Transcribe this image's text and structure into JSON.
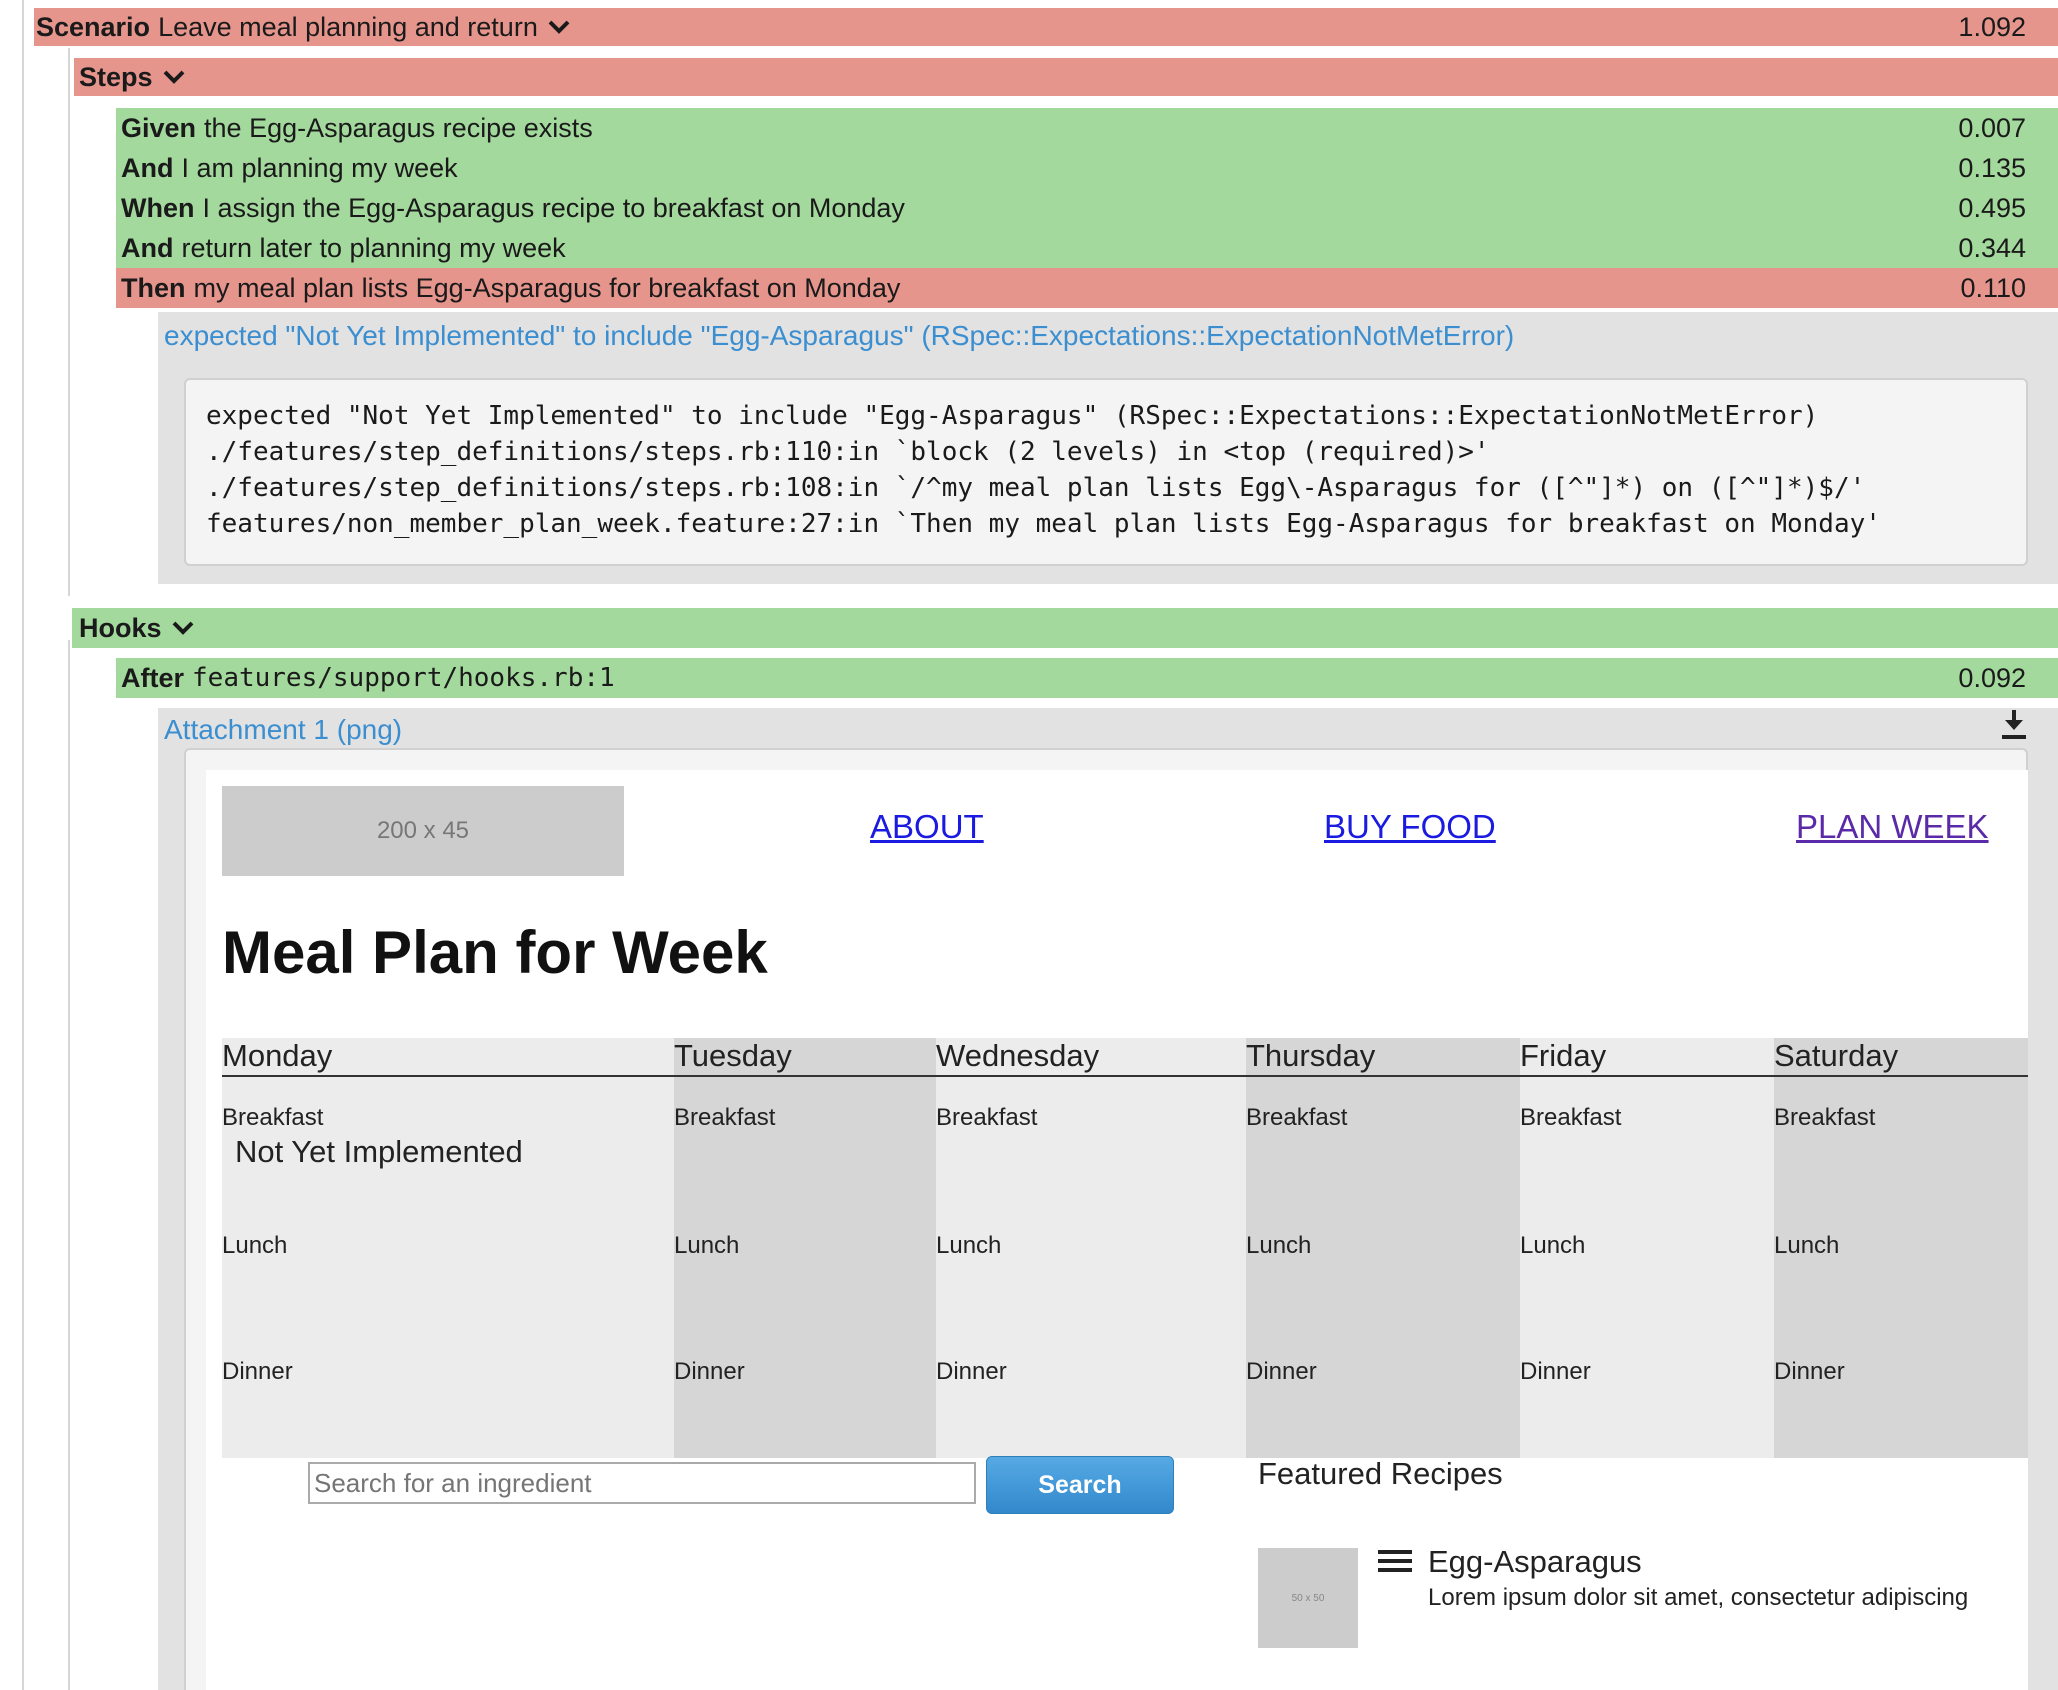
{
  "scenario": {
    "keyword": "Scenario",
    "name": "Leave meal planning and return",
    "time": "1.092"
  },
  "steps_section": {
    "label": "Steps"
  },
  "steps": [
    {
      "keyword": "Given",
      "text": "the Egg-Asparagus recipe exists",
      "time": "0.007",
      "status": "passed"
    },
    {
      "keyword": "And",
      "text": "I am planning my week",
      "time": "0.135",
      "status": "passed"
    },
    {
      "keyword": "When",
      "text": "I assign the Egg-Asparagus recipe to breakfast on Monday",
      "time": "0.495",
      "status": "passed"
    },
    {
      "keyword": "And",
      "text": "return later to planning my week",
      "time": "0.344",
      "status": "passed"
    },
    {
      "keyword": "Then",
      "text": "my meal plan lists Egg-Asparagus for breakfast on Monday",
      "time": "0.110",
      "status": "failed"
    }
  ],
  "error": {
    "message": "expected \"Not Yet Implemented\" to include \"Egg-Asparagus\" (RSpec::Expectations::ExpectationNotMetError)",
    "trace": [
      "expected \"Not Yet Implemented\" to include \"Egg-Asparagus\" (RSpec::Expectations::ExpectationNotMetError)",
      "./features/step_definitions/steps.rb:110:in `block (2 levels) in <top (required)>'",
      "./features/step_definitions/steps.rb:108:in `/^my meal plan lists Egg\\-Asparagus for ([^\"]*) on ([^\"]*)$/'",
      "features/non_member_plan_week.feature:27:in `Then my meal plan lists Egg-Asparagus for breakfast on Monday'"
    ]
  },
  "hooks_section": {
    "label": "Hooks"
  },
  "hook": {
    "keyword": "After",
    "location": "features/support/hooks.rb:1",
    "time": "0.092"
  },
  "attachment": {
    "label": "Attachment 1 (png)",
    "download_icon": "download-icon"
  },
  "screenshot": {
    "logo_placeholder": "200 x 45",
    "nav": [
      "ABOUT",
      "BUY FOOD",
      "PLAN WEEK"
    ],
    "heading": "Meal Plan for Week",
    "days": [
      "Monday",
      "Tuesday",
      "Wednesday",
      "Thursday",
      "Friday",
      "Saturday"
    ],
    "meals": [
      "Breakfast",
      "Lunch",
      "Dinner"
    ],
    "monday_breakfast_value": "Not Yet Implemented",
    "search": {
      "placeholder": "Search for an ingredient",
      "button": "Search"
    },
    "featured": {
      "title": "Featured Recipes",
      "thumb_placeholder": "50 x 50",
      "recipe_name": "Egg-Asparagus",
      "recipe_desc": "Lorem ipsum dolor sit amet, consectetur adipiscing"
    }
  },
  "colors": {
    "failed": "#e6958d",
    "passed": "#a3d99c",
    "link": "#3b8ed0",
    "search_button": "#3f9bdc"
  }
}
